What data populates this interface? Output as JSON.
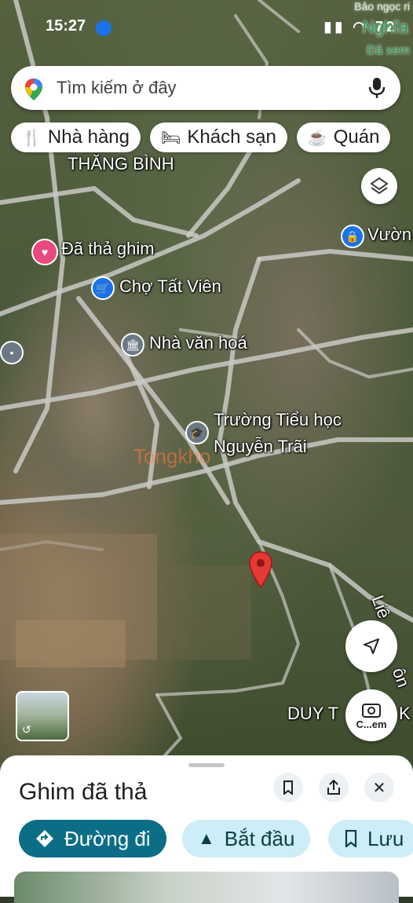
{
  "status_bar": {
    "time": "15:27",
    "icons": "▮▮ ◠ 72"
  },
  "top_corner": {
    "line1": "Bảo ngọc ri",
    "line2": "Nghĩa",
    "line3": "Đã xem"
  },
  "search": {
    "placeholder": "Tìm kiếm ở đây"
  },
  "chips": [
    {
      "label": "Nhà hàng",
      "icon": "fork-knife-icon"
    },
    {
      "label": "Khách sạn",
      "icon": "bed-icon"
    },
    {
      "label": "Quán",
      "icon": "cup-icon"
    }
  ],
  "map_labels": {
    "area": "THĂNG BÌNH",
    "dropped_pin": "Đã thả ghim",
    "market": "Chợ Tất Viên",
    "cultural_house": "Nhà văn hoá",
    "school_line1": "Trường Tiểu học",
    "school_line2": "Nguyễn Trãi",
    "garden": "Vườn",
    "bottom_area": "DUY T",
    "bottom_area_suffix": "K",
    "road_right": "Liê",
    "road_right2": "ôn",
    "watermark": "Tongkho"
  },
  "camera_fab_label": "C...em",
  "sheet": {
    "title": "Ghim đã thả",
    "actions": {
      "directions": "Đường đi",
      "start": "Bắt đầu",
      "save": "Lưu"
    }
  },
  "colors": {
    "primary": "#0b6e86",
    "tonal": "#cdeef6",
    "pin": "#e53935"
  }
}
